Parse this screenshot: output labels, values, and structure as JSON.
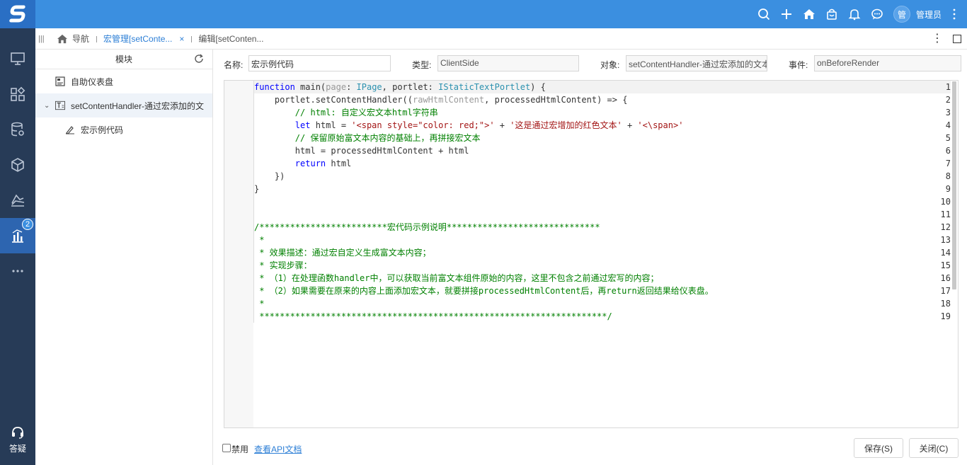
{
  "topbar": {
    "logo_text": "S",
    "icons": [
      "search-icon",
      "plus-icon",
      "home-icon",
      "bag-icon",
      "bell-icon",
      "chat-icon"
    ],
    "avatar_text": "管",
    "username": "管理员",
    "accent": "#3b8fe0"
  },
  "rail": {
    "items": [
      "monitor-icon",
      "widgets-icon",
      "database-gear-icon",
      "cube-icon",
      "chart-layers-icon",
      "bar-chart-icon",
      "more-icon"
    ],
    "active_badge": "2",
    "help_label": "答疑"
  },
  "tabs": {
    "nav_label": "导航",
    "items": [
      {
        "label": "宏管理[setConte...",
        "active": true
      },
      {
        "label": "编辑[setConten...",
        "active": false
      }
    ],
    "close_glyph": "×"
  },
  "panel": {
    "title": "模块",
    "tree": [
      {
        "label": "自助仪表盘",
        "icon": "dashboard-icon"
      },
      {
        "label": "setContentHandler-通过宏添加的文",
        "icon": "text-icon"
      },
      {
        "label": "宏示例代码",
        "icon": "macro-icon"
      }
    ]
  },
  "form": {
    "name_label": "名称:",
    "name_value": "宏示例代码",
    "type_label": "类型:",
    "type_value": "ClientSide",
    "object_label": "对象:",
    "object_value": "setContentHandler-通过宏添加的文本",
    "event_label": "事件:",
    "event_value": "onBeforeRender"
  },
  "editor": {
    "line_numbers": [
      "1",
      "2",
      "3",
      "4",
      "5",
      "6",
      "7",
      "8",
      "9",
      "10",
      "11",
      "12",
      "13",
      "14",
      "15",
      "16",
      "17",
      "18",
      "19"
    ],
    "lines": [
      [
        {
          "t": "function",
          "c": "kw"
        },
        {
          "t": " main(",
          "c": ""
        },
        {
          "t": "page",
          "c": "pm"
        },
        {
          "t": ": ",
          "c": ""
        },
        {
          "t": "IPage",
          "c": "ty"
        },
        {
          "t": ", portlet: ",
          "c": ""
        },
        {
          "t": "IStaticTextPortlet",
          "c": "ty"
        },
        {
          "t": ") {",
          "c": ""
        }
      ],
      [
        {
          "t": "    portlet.setContentHandler((",
          "c": ""
        },
        {
          "t": "rawHtmlContent",
          "c": "pm"
        },
        {
          "t": ", processedHtmlContent) => {",
          "c": ""
        }
      ],
      [
        {
          "t": "        // html: 自定义宏文本html字符串",
          "c": "cm"
        }
      ],
      [
        {
          "t": "        ",
          "c": ""
        },
        {
          "t": "let",
          "c": "kw"
        },
        {
          "t": " html = ",
          "c": ""
        },
        {
          "t": "'<span style=\"color: red;\">'",
          "c": "str"
        },
        {
          "t": " + ",
          "c": ""
        },
        {
          "t": "'这是通过宏增加的红色文本'",
          "c": "str"
        },
        {
          "t": " + ",
          "c": ""
        },
        {
          "t": "'<\\span>'",
          "c": "str"
        }
      ],
      [
        {
          "t": "        // 保留原始富文本内容的基础上，再拼接宏文本",
          "c": "cm"
        }
      ],
      [
        {
          "t": "        html = processedHtmlContent + html",
          "c": ""
        }
      ],
      [
        {
          "t": "        ",
          "c": ""
        },
        {
          "t": "return",
          "c": "kw"
        },
        {
          "t": " html",
          "c": ""
        }
      ],
      [
        {
          "t": "    })",
          "c": ""
        }
      ],
      [
        {
          "t": "}",
          "c": ""
        }
      ],
      [
        {
          "t": "",
          "c": ""
        }
      ],
      [
        {
          "t": "",
          "c": ""
        }
      ],
      [
        {
          "t": "/*************************宏代码示例说明******************************",
          "c": "cm"
        }
      ],
      [
        {
          "t": " *",
          "c": "cm"
        }
      ],
      [
        {
          "t": " * 效果描述：通过宏自定义生成富文本内容；",
          "c": "cm"
        }
      ],
      [
        {
          "t": " * 实现步骤：",
          "c": "cm"
        }
      ],
      [
        {
          "t": " * （1）在处理函数handler中，可以获取当前富文本组件原始的内容，这里不包含之前通过宏写的内容；",
          "c": "cm"
        }
      ],
      [
        {
          "t": " * （2）如果需要在原来的内容上面添加宏文本，就要拼接processedHtmlContent后，再return返回结果给仪表盘。",
          "c": "cm"
        }
      ],
      [
        {
          "t": " *",
          "c": "cm"
        }
      ],
      [
        {
          "t": " ********************************************************************/",
          "c": "cm"
        }
      ]
    ]
  },
  "footer": {
    "disable_label": "禁用",
    "api_link": "查看API文档",
    "save_label": "保存(S)",
    "close_label": "关闭(C)"
  }
}
